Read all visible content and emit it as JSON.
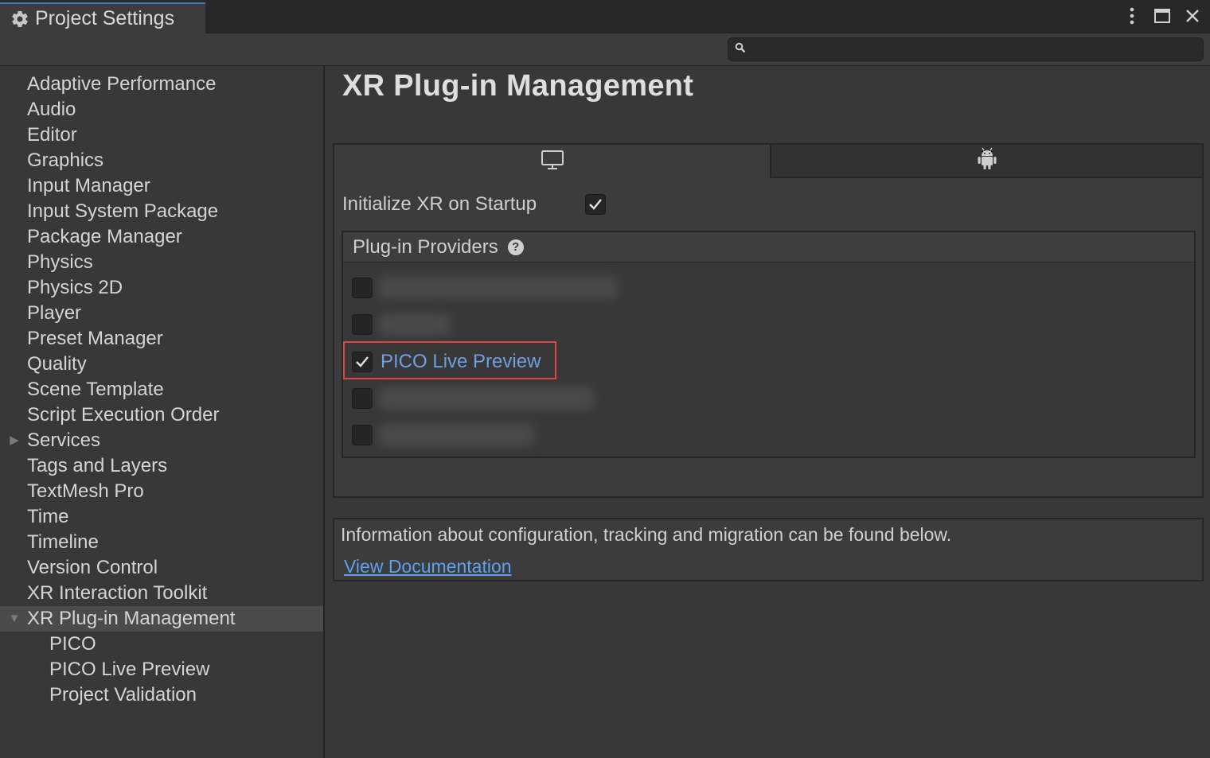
{
  "window": {
    "tab_title": "Project Settings",
    "tab_icon": "gear-icon"
  },
  "search": {
    "placeholder": "",
    "value": ""
  },
  "sidebar": {
    "items": [
      {
        "label": "Adaptive Performance"
      },
      {
        "label": "Audio"
      },
      {
        "label": "Editor"
      },
      {
        "label": "Graphics"
      },
      {
        "label": "Input Manager"
      },
      {
        "label": "Input System Package"
      },
      {
        "label": "Package Manager"
      },
      {
        "label": "Physics"
      },
      {
        "label": "Physics 2D"
      },
      {
        "label": "Player"
      },
      {
        "label": "Preset Manager"
      },
      {
        "label": "Quality"
      },
      {
        "label": "Scene Template"
      },
      {
        "label": "Script Execution Order"
      },
      {
        "label": "Services",
        "expandable": true,
        "expanded": false
      },
      {
        "label": "Tags and Layers"
      },
      {
        "label": "TextMesh Pro"
      },
      {
        "label": "Time"
      },
      {
        "label": "Timeline"
      },
      {
        "label": "Version Control"
      },
      {
        "label": "XR Interaction Toolkit"
      },
      {
        "label": "XR Plug-in Management",
        "expandable": true,
        "expanded": true,
        "selected": true
      },
      {
        "label": "PICO",
        "sub": true
      },
      {
        "label": "PICO Live Preview",
        "sub": true
      },
      {
        "label": "Project Validation",
        "sub": true
      }
    ]
  },
  "main": {
    "title": "XR Plug-in Management",
    "platform_tabs": [
      {
        "icon": "desktop-monitor-icon",
        "active": true
      },
      {
        "icon": "android-icon",
        "active": false
      }
    ],
    "init_xr_label": "Initialize XR on Startup",
    "init_xr_checked": true,
    "providers_header": "Plug-in Providers",
    "providers": [
      {
        "label": "",
        "checked": false,
        "blurred": true
      },
      {
        "label": "",
        "checked": false,
        "blurred": true
      },
      {
        "label": "PICO Live Preview",
        "checked": true,
        "blurred": false,
        "highlighted": true
      },
      {
        "label": "",
        "checked": false,
        "blurred": true
      },
      {
        "label": "",
        "checked": false,
        "blurred": true
      }
    ],
    "info_text": "Information about configuration, tracking and migration can be found below.",
    "doc_link": "View Documentation"
  },
  "colors": {
    "highlight_border": "#e04545",
    "link": "#5da0f0",
    "provider_label": "#6f9fe0",
    "tab_accent": "#3a79bb"
  }
}
